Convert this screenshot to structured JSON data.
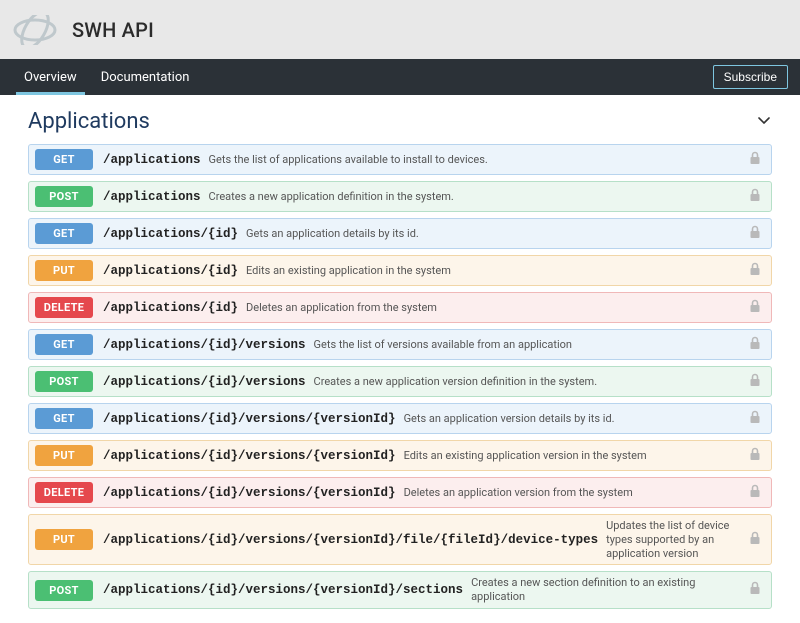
{
  "header": {
    "title": "SWH API"
  },
  "nav": {
    "items": [
      {
        "label": "Overview",
        "active": true
      },
      {
        "label": "Documentation",
        "active": false
      }
    ],
    "subscribe": "Subscribe"
  },
  "section": {
    "title": "Applications"
  },
  "ops": [
    {
      "method": "GET",
      "path": "/applications",
      "desc": "Gets the list of applications available to install to devices."
    },
    {
      "method": "POST",
      "path": "/applications",
      "desc": "Creates a new application definition in the system."
    },
    {
      "method": "GET",
      "path": "/applications/{id}",
      "desc": "Gets an application details by its id."
    },
    {
      "method": "PUT",
      "path": "/applications/{id}",
      "desc": "Edits an existing application in the system"
    },
    {
      "method": "DELETE",
      "path": "/applications/{id}",
      "desc": "Deletes an application from the system"
    },
    {
      "method": "GET",
      "path": "/applications/{id}/versions",
      "desc": "Gets the list of versions available from an application"
    },
    {
      "method": "POST",
      "path": "/applications/{id}/versions",
      "desc": "Creates a new application version definition in the system."
    },
    {
      "method": "GET",
      "path": "/applications/{id}/versions/{versionId}",
      "desc": "Gets an application version details by its id."
    },
    {
      "method": "PUT",
      "path": "/applications/{id}/versions/{versionId}",
      "desc": "Edits an existing application version in the system"
    },
    {
      "method": "DELETE",
      "path": "/applications/{id}/versions/{versionId}",
      "desc": "Deletes an application version from the system"
    },
    {
      "method": "PUT",
      "path": "/applications/{id}/versions/{versionId}/file/{fileId}/device-types",
      "desc": "Updates the list of device types supported by an application version"
    },
    {
      "method": "POST",
      "path": "/applications/{id}/versions/{versionId}/sections",
      "desc": "Creates a new section definition to an existing application"
    }
  ]
}
